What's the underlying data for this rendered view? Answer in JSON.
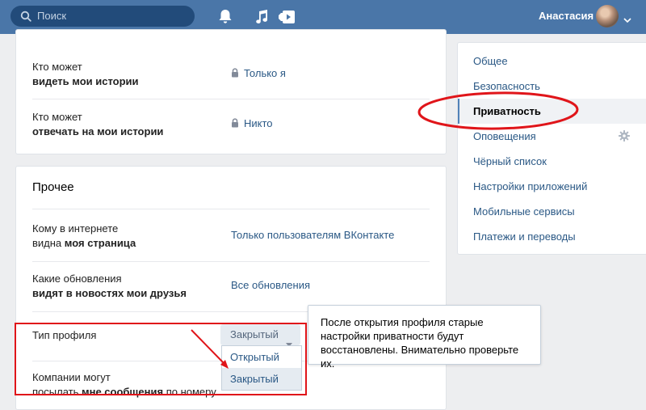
{
  "header": {
    "search_placeholder": "Поиск",
    "user_name": "Анастасия",
    "icons": [
      "search-icon",
      "bell-icon",
      "music-icon",
      "video-icon",
      "chevron-down-icon"
    ],
    "accent_color": "#4a76a8"
  },
  "privacy_top": {
    "rows": [
      {
        "label_line1": "Кто может",
        "label_line2": "видеть мои истории",
        "value": "Только я",
        "icon": "lock-icon"
      },
      {
        "label_line1": "Кто может",
        "label_line2": "отвечать на мои истории",
        "value": "Никто",
        "icon": "lock-icon"
      }
    ]
  },
  "other": {
    "title": "Прочее",
    "rows": [
      {
        "label_line1": "Кому в интернете",
        "label_line2_plain": "видна ",
        "label_line2_bold": "моя страница",
        "value": "Только пользователям ВКонтакте"
      },
      {
        "label_line1": "Какие обновления",
        "label_line2": "видят в новостях мои друзья",
        "value": "Все обновления"
      }
    ],
    "profile_type": {
      "label": "Тип профиля",
      "selected": "Закрытый",
      "options": [
        "Открытый",
        "Закрытый"
      ]
    },
    "companies": {
      "label_line1": "Компании могут",
      "label_line2_plain": "посылать ",
      "label_line2_bold": "мне сообщения",
      "label_line2_tail": " по номеру"
    }
  },
  "tooltip": {
    "text": "После открытия профиля старые настройки приватности будут восстановлены. Внимательно проверьте их."
  },
  "sidebar": {
    "items": [
      {
        "label": "Общее"
      },
      {
        "label": "Безопасность"
      },
      {
        "label": "Приватность",
        "active": true
      },
      {
        "label": "Оповещения"
      },
      {
        "label": "Чёрный список"
      },
      {
        "label": "Настройки приложений"
      },
      {
        "label": "Мобильные сервисы"
      },
      {
        "label": "Платежи и переводы"
      }
    ]
  },
  "annotation_color": "#e0151a"
}
